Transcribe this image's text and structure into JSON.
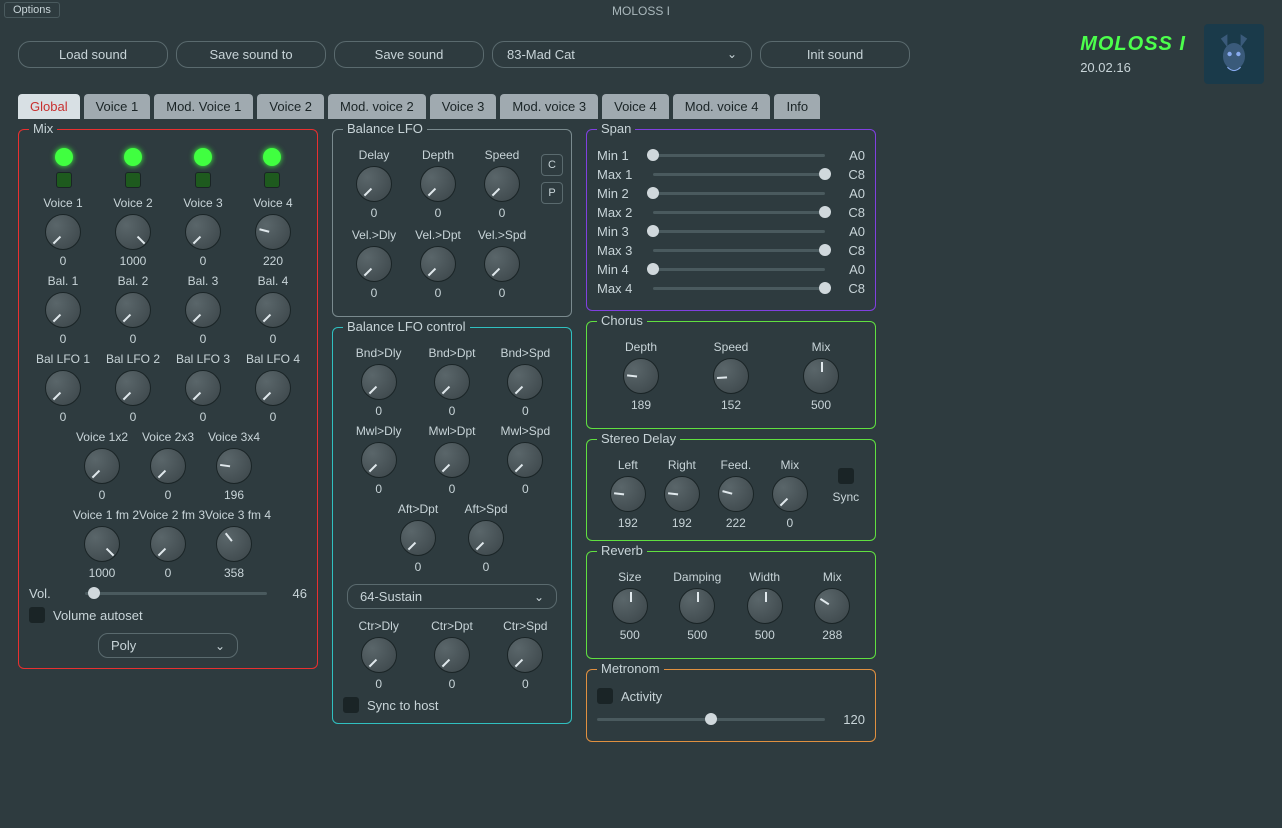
{
  "app": {
    "title": "MOLOSS I",
    "options_label": "Options"
  },
  "toolbar": {
    "load": "Load sound",
    "save_to": "Save sound to",
    "save": "Save sound",
    "preset": "83-Mad Cat",
    "init": "Init sound"
  },
  "brand": {
    "name": "MOLOSS I",
    "version": "20.02.16"
  },
  "tabs": [
    "Global",
    "Voice 1",
    "Mod. Voice 1",
    "Voice 2",
    "Mod. voice 2",
    "Voice 3",
    "Mod. voice 3",
    "Voice 4",
    "Mod. voice 4",
    "Info"
  ],
  "active_tab": 0,
  "mix": {
    "title": "Mix",
    "voice_labels": [
      "Voice 1",
      "Voice 2",
      "Voice 3",
      "Voice 4"
    ],
    "voice_vals": [
      "0",
      "1000",
      "0",
      "220"
    ],
    "bal_labels": [
      "Bal. 1",
      "Bal. 2",
      "Bal. 3",
      "Bal. 4"
    ],
    "bal_vals": [
      "0",
      "0",
      "0",
      "0"
    ],
    "ballfo_labels": [
      "Bal LFO 1",
      "Bal LFO 2",
      "Bal LFO 3",
      "Bal LFO 4"
    ],
    "ballfo_vals": [
      "0",
      "0",
      "0",
      "0"
    ],
    "cross_labels": [
      "Voice 1x2",
      "Voice 2x3",
      "Voice 3x4"
    ],
    "cross_vals": [
      "0",
      "0",
      "196"
    ],
    "fm_labels": [
      "Voice 1 fm 2",
      "Voice 2 fm 3",
      "Voice 3 fm 4"
    ],
    "fm_vals": [
      "1000",
      "0",
      "358"
    ],
    "vol_label": "Vol.",
    "vol_val": "46",
    "autoset": "Volume autoset",
    "poly": "Poly"
  },
  "balance_lfo": {
    "title": "Balance LFO",
    "row1_labels": [
      "Delay",
      "Depth",
      "Speed"
    ],
    "row1_vals": [
      "0",
      "0",
      "0"
    ],
    "row2_labels": [
      "Vel.>Dly",
      "Vel.>Dpt",
      "Vel.>Spd"
    ],
    "row2_vals": [
      "0",
      "0",
      "0"
    ],
    "c": "C",
    "p": "P"
  },
  "balance_ctrl": {
    "title": "Balance LFO control",
    "bnd_labels": [
      "Bnd>Dly",
      "Bnd>Dpt",
      "Bnd>Spd"
    ],
    "bnd_vals": [
      "0",
      "0",
      "0"
    ],
    "mwl_labels": [
      "Mwl>Dly",
      "Mwl>Dpt",
      "Mwl>Spd"
    ],
    "mwl_vals": [
      "0",
      "0",
      "0"
    ],
    "aft_labels": [
      "Aft>Dpt",
      "Aft>Spd"
    ],
    "aft_vals": [
      "0",
      "0"
    ],
    "ctrl_sel": "64-Sustain",
    "ctr_labels": [
      "Ctr>Dly",
      "Ctr>Dpt",
      "Ctr>Spd"
    ],
    "ctr_vals": [
      "0",
      "0",
      "0"
    ],
    "sync": "Sync to host"
  },
  "span": {
    "title": "Span",
    "rows": [
      {
        "lbl": "Min 1",
        "val": "A0",
        "pos": 0
      },
      {
        "lbl": "Max 1",
        "val": "C8",
        "pos": 100
      },
      {
        "lbl": "Min 2",
        "val": "A0",
        "pos": 0
      },
      {
        "lbl": "Max 2",
        "val": "C8",
        "pos": 100
      },
      {
        "lbl": "Min 3",
        "val": "A0",
        "pos": 0
      },
      {
        "lbl": "Max 3",
        "val": "C8",
        "pos": 100
      },
      {
        "lbl": "Min 4",
        "val": "A0",
        "pos": 0
      },
      {
        "lbl": "Max 4",
        "val": "C8",
        "pos": 100
      }
    ]
  },
  "chorus": {
    "title": "Chorus",
    "labels": [
      "Depth",
      "Speed",
      "Mix"
    ],
    "vals": [
      "189",
      "152",
      "500"
    ]
  },
  "stereo": {
    "title": "Stereo Delay",
    "labels": [
      "Left",
      "Right",
      "Feed.",
      "Mix"
    ],
    "vals": [
      "192",
      "192",
      "222",
      "0"
    ],
    "sync": "Sync"
  },
  "reverb": {
    "title": "Reverb",
    "labels": [
      "Size",
      "Damping",
      "Width",
      "Mix"
    ],
    "vals": [
      "500",
      "500",
      "500",
      "288"
    ]
  },
  "metro": {
    "title": "Metronom",
    "activity": "Activity",
    "tempo": "120"
  }
}
